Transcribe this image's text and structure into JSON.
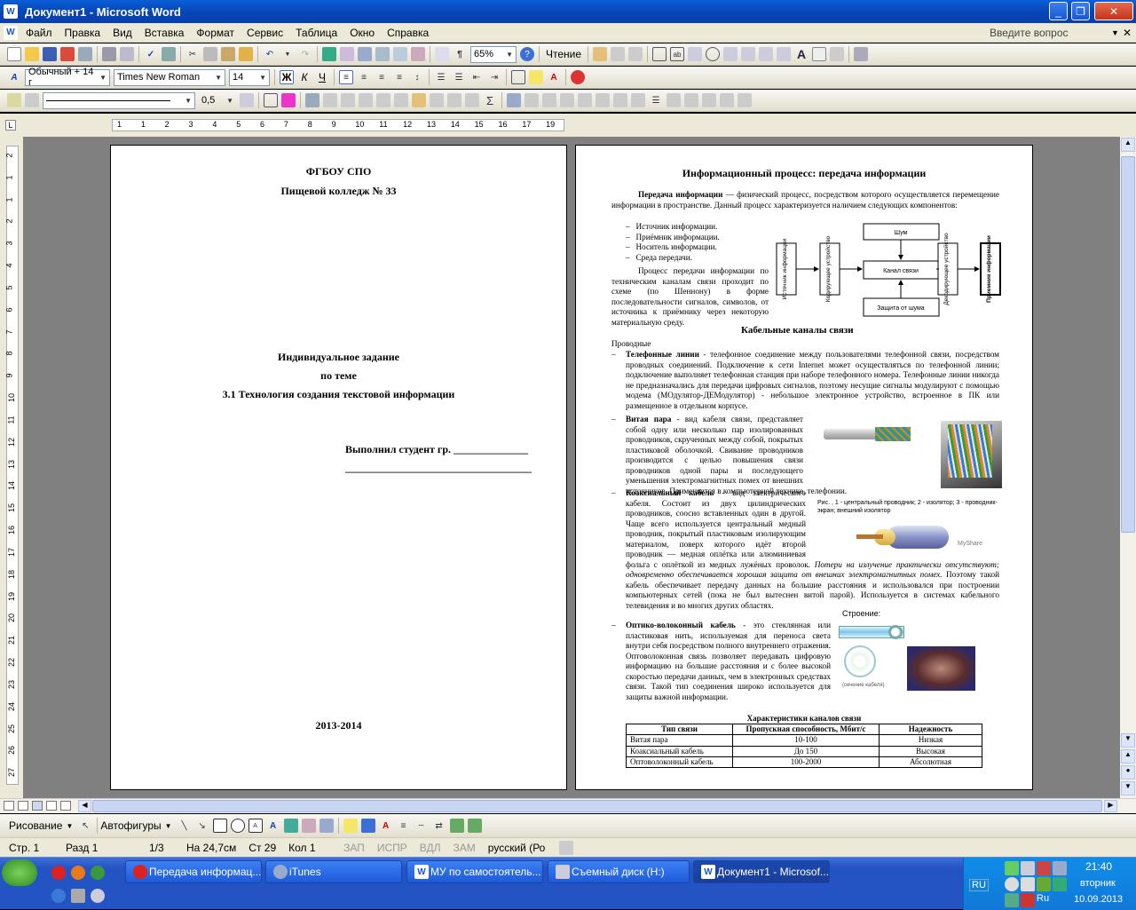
{
  "window": {
    "title": "Документ1 - Microsoft Word"
  },
  "menu": {
    "items": [
      "Файл",
      "Правка",
      "Вид",
      "Вставка",
      "Формат",
      "Сервис",
      "Таблица",
      "Окно",
      "Справка"
    ],
    "help_placeholder": "Введите вопрос"
  },
  "toolbar": {
    "zoom": "65%",
    "reading": "Чтение"
  },
  "format": {
    "style": "Обычный + 14 г",
    "font": "Times New Roman",
    "size": "14"
  },
  "drawing_tb": {
    "line_width": "0,5"
  },
  "ruler_nums": [
    "1",
    "1",
    "2",
    "3",
    "4",
    "5",
    "6",
    "7",
    "8",
    "9",
    "10",
    "11",
    "12",
    "13",
    "14",
    "15",
    "16",
    "17",
    "19"
  ],
  "vruler_nums": [
    "2",
    "1",
    "1",
    "2",
    "3",
    "4",
    "5",
    "6",
    "7",
    "8",
    "9",
    "10",
    "11",
    "12",
    "13",
    "14",
    "15",
    "16",
    "17",
    "18",
    "19",
    "20",
    "21",
    "22",
    "23",
    "24",
    "25",
    "26",
    "27"
  ],
  "page1": {
    "org": "ФГБОУ СПО",
    "college": "Пищевой колледж № 33",
    "task": "Индивидуальное задание",
    "topic_pre": "по теме",
    "topic": "3.1 Технология создания текстовой информации",
    "student": "Выполнил студент гр. ______________",
    "line": "___________________________________",
    "years": "2013-2014"
  },
  "page2": {
    "title": "Информационный процесс: передача информации",
    "intro_bold": "Передача информации",
    "intro_rest": " — физический процесс, посредством которого осуществляется перемещение информации в пространстве. Данный процесс характеризуется наличием следующих компонентов:",
    "components": [
      "Источник информации.",
      "Приёмник информации.",
      "Носитель информации.",
      "Среда передачи."
    ],
    "process": "Процесс передачи информации по техническим каналам связи проходит по схеме (по Шеннону) в форме последовательности сигналов, символов, от источника к приёмнику через некоторую материальную среду.",
    "diagram": {
      "source": "Источник информации",
      "encoder": "Кодирующее устройство",
      "noise": "Шум",
      "channel": "Канал связи",
      "protect": "Защита от шума",
      "decoder": "Декодирующее устройство",
      "receiver": "Приемник информации"
    },
    "cable_title": "Кабельные каналы связи",
    "wired": "Проводные",
    "phone_b": "Телефонные линии",
    "phone": " - телефонное соединение между пользователями телефонной связи, посредством проводных соединений. Подключение к сети Internet может осуществляться по телефонной линии; подключение выполняет телефонная станция при наборе телефонного номера. Телефонные линии никогда не предназначались для передачи цифровых сигналов, поэтому несущие сигналы модулируют с помощью модема (МОдулятор-ДЕМодулятор) - небольшое электронное устройство, встроенное в ПК или размещенное в отдельном корпусе.",
    "twisted_b": "Витая пара",
    "twisted": " - вид кабеля связи, представляет собой одну или несколько пар изолированных проводников, скрученных между собой, покрытых пластиковой оболочкой. Свивание проводников производится с целью повышения связи проводников одной пары и последующего уменьшения электромагнитных помех от внешних источников. Применяется в компьютерной технике, телефонии.",
    "coax_b": "Коаксиальный кабель",
    "coax": " - вид электрического кабеля. Состоит из двух цилиндрических проводников, соосно вставленных один в другой. Чаще всего используется центральный медный проводник, покрытый пластиковым изолирующим материалом, поверх которого идёт второй проводник — медная оплётка или алюминиевая фольга с оплёткой из медных лужёных проволок.",
    "coax_it": " Потери на излучение практически отсутствуют; одновременно обеспечивается хорошая защита от внешних электромагнитных помех.",
    "coax2": " Поэтому такой кабель обеспечивает передачу данных на большие расстояния и использовался при построении компьютерных сетей (пока не был вытеснен витой парой). Используется в системах кабельного телевидения и во многих других областях.",
    "coax_caption": "Рис. , 1 - центральный проводник; 2 - изолятор; 3 - проводник-экран; внешний изолятор",
    "myshare": "MyShare",
    "fiber_b": "Оптико-волоконный кабель",
    "fiber": " - это стеклянная или пластиковая нить, используемая для переноса света внутри себя посредством полного внутреннего отражения. Оптоволоконная связь позволяет передавать цифровую информацию на большие расстояния и с более высокой скоростью передачи данных, чем в электронных средствах связи. Такой тип соединения широко используется для защиты важной информации.",
    "structure": "Строение:",
    "section_label": "(сечение кабеля)",
    "table_title": "Характеристики каналов связи",
    "table": {
      "headers": [
        "Тип связи",
        "Пропускная способность, Мбит/с",
        "Надежность"
      ],
      "rows": [
        [
          "Витая пара",
          "10-100",
          "Низкая"
        ],
        [
          "Коаксиальный кабель",
          "До 150",
          "Высокая"
        ],
        [
          "Оптоволоконный кабель",
          "100-2000",
          "Абсолютная"
        ]
      ]
    }
  },
  "drawing": {
    "label": "Рисование",
    "autoshapes": "Автофигуры"
  },
  "status": {
    "page": "Стр. 1",
    "section": "Разд 1",
    "pages": "1/3",
    "at": "На 24,7см",
    "line": "Ст 29",
    "col": "Кол 1",
    "rec": "ЗАП",
    "trk": "ИСПР",
    "ext": "ВДЛ",
    "ovr": "ЗАМ",
    "lang": "русский (Ро"
  },
  "taskbar": {
    "tasks": [
      "Передача информац...",
      "iTunes",
      "МУ по самостоятель...",
      "Съемный диск (H:)",
      "Документ1 - Microsof..."
    ],
    "lang": "RU",
    "time": "21:40",
    "day": "вторник",
    "date": "10.09.2013",
    "ru2": "Ru"
  }
}
